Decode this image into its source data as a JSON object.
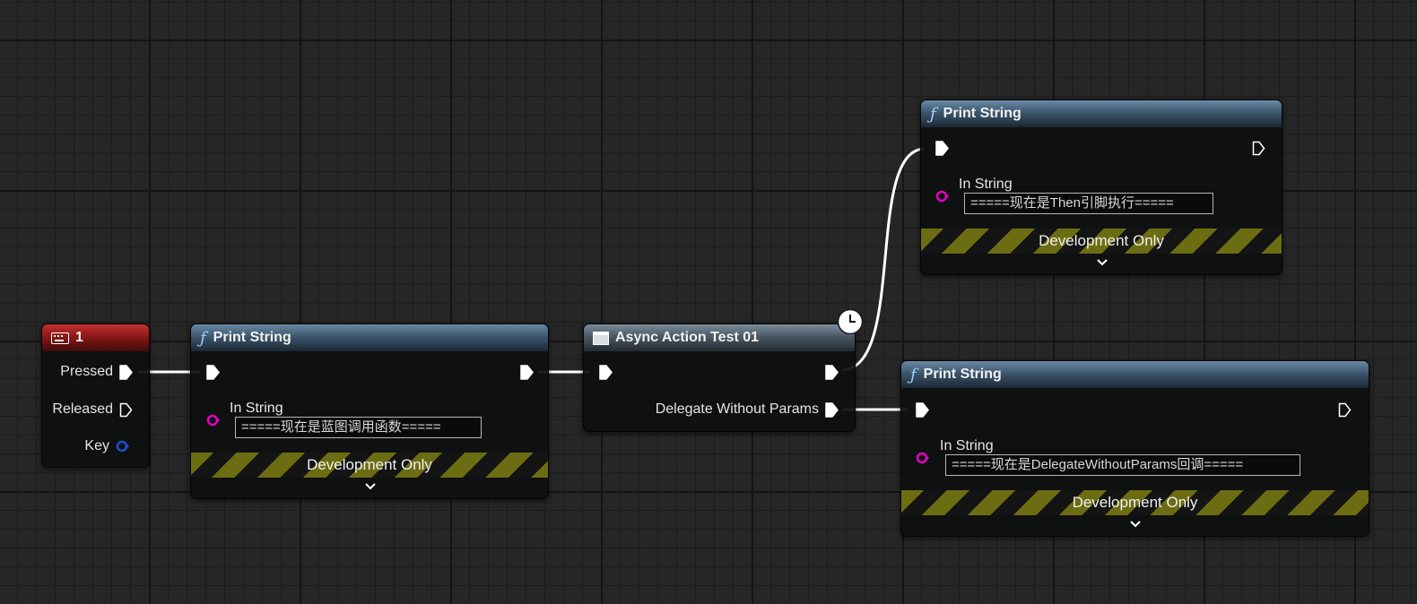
{
  "key_event": {
    "title": "1",
    "pins": {
      "pressed": "Pressed",
      "released": "Released",
      "key": "Key"
    }
  },
  "print_string_1": {
    "title": "Print String",
    "in_string_label": "In String",
    "in_string_value": "=====现在是蓝图调用函数=====",
    "dev_only": "Development Only"
  },
  "async_action": {
    "title": "Async Action Test 01",
    "delegate_label": "Delegate Without Params"
  },
  "print_string_2": {
    "title": "Print String",
    "in_string_label": "In String",
    "in_string_value": "=====现在是Then引脚执行=====",
    "dev_only": "Development Only"
  },
  "print_string_3": {
    "title": "Print String",
    "in_string_label": "In String",
    "in_string_value": "=====现在是DelegateWithoutParams回调=====",
    "dev_only": "Development Only"
  },
  "colors": {
    "wire": "#ffffff",
    "string_pin": "#e600c8",
    "struct_pin": "#1b4fd6",
    "func_header": "#3c566d",
    "event_header": "#851616"
  },
  "icons": {
    "function": "function-icon",
    "keyboard": "keyboard-icon",
    "async": "window-icon",
    "latent": "clock-icon"
  }
}
